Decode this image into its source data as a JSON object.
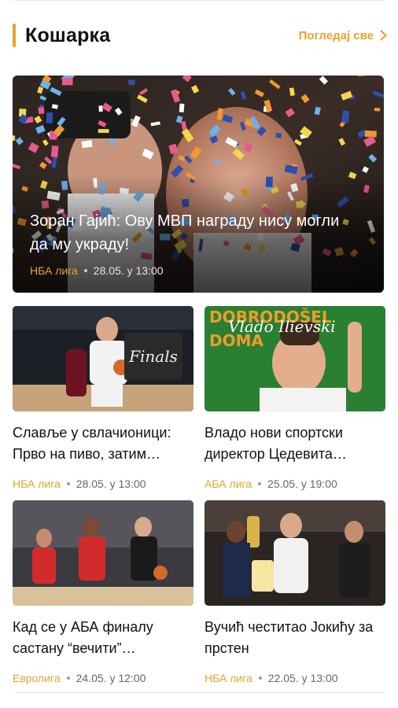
{
  "colors": {
    "accent": "#e8a22b",
    "meta_text": "#666666"
  },
  "section": {
    "title": "Кошарка",
    "see_all_label": "Погледај све",
    "see_all_icon": "chevron-right-icon"
  },
  "hero": {
    "title": "Зоран Гајић: Ову МВП награду нису могли да му украду!",
    "category": "НБА лига",
    "date": "28.05. у 13:00"
  },
  "cards": [
    {
      "title": "Славље у свлачионици: Прво на пиво, затим…",
      "category": "НБА лига",
      "date": "28.05. у 13:00"
    },
    {
      "title": "Владо нови спортски директор Цедевита…",
      "category": "АБА лига",
      "date": "25.05. у 19:00"
    },
    {
      "title": "Кад се у АБА финалу састану “вечити”…",
      "category": "Евролига",
      "date": "24.05. у 12:00"
    },
    {
      "title": "Вучић честитао Јокићу за прстен",
      "category": "НБА лига",
      "date": "22.05. у 13:00"
    }
  ],
  "images": {
    "card1_logo": "Finals",
    "card2_poster_line1": "DOBRODOŠEL",
    "card2_poster_line2": "DOMA",
    "card2_poster_script": "Vlado Ilievski"
  }
}
